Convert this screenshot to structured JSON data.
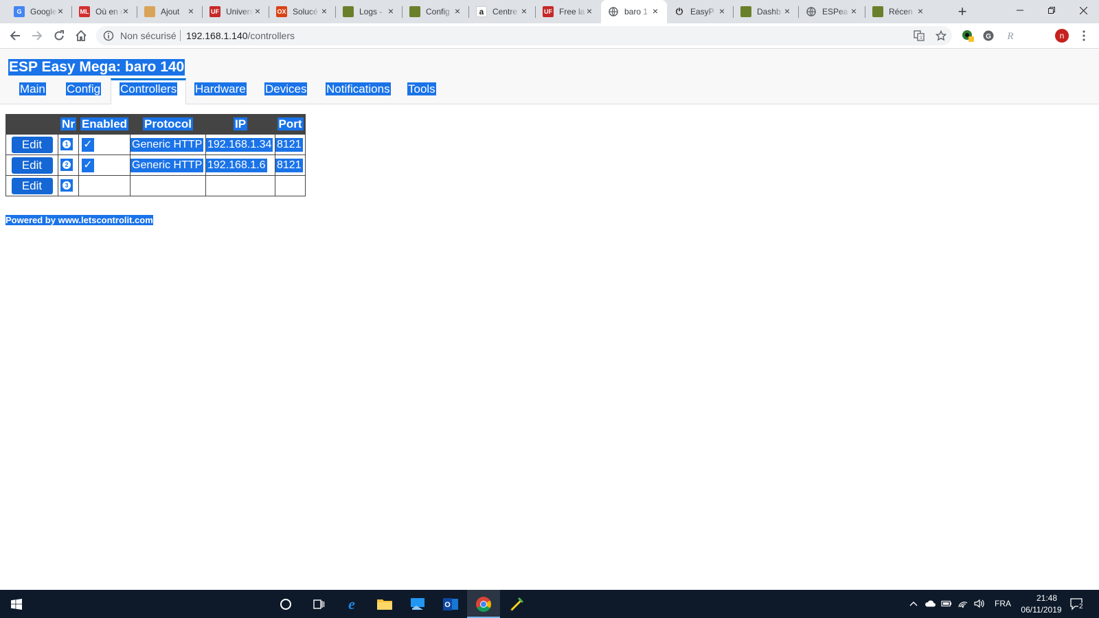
{
  "browser": {
    "tabs": [
      {
        "title": "Google",
        "favicon": "google-gsuite-icon",
        "color": "#4285f4"
      },
      {
        "title": "Où en est",
        "favicon": "ml-icon",
        "color": "#d32f2f"
      },
      {
        "title": "Ajout",
        "favicon": "box-icon",
        "color": "#d9a45a"
      },
      {
        "title": "Univers",
        "favicon": "uf-icon",
        "color": "#c62828"
      },
      {
        "title": "Solucé",
        "favicon": "solucee-icon",
        "color": "#d84315"
      },
      {
        "title": "Logs -",
        "favicon": "letscontrolit-icon",
        "color": "#6a7f2c"
      },
      {
        "title": "Config",
        "favicon": "letscontrolit-icon",
        "color": "#6a7f2c"
      },
      {
        "title": "Centre",
        "favicon": "amazon-icon",
        "color": "#222222"
      },
      {
        "title": "Free la",
        "favicon": "uf-icon",
        "color": "#c62828"
      },
      {
        "title": "baro 1",
        "favicon": "globe-icon",
        "color": "#5f6368",
        "active": true
      },
      {
        "title": "EasyP",
        "favicon": "power-icon",
        "color": "#222222"
      },
      {
        "title": "Dashb",
        "favicon": "letscontrolit-icon",
        "color": "#6a7f2c"
      },
      {
        "title": "ESPea",
        "favicon": "globe-icon",
        "color": "#5f6368"
      },
      {
        "title": "Récen",
        "favicon": "letscontrolit-icon",
        "color": "#6a7f2c"
      }
    ],
    "omnibox": {
      "security_label": "Non sécurisé",
      "host": "192.168.1.140",
      "path": "/controllers"
    },
    "profile_initial": "n"
  },
  "page": {
    "title": "ESP Easy Mega: baro 140",
    "menu": [
      {
        "label": "Main"
      },
      {
        "label": "Config"
      },
      {
        "label": "Controllers",
        "active": true
      },
      {
        "label": "Hardware"
      },
      {
        "label": "Devices"
      },
      {
        "label": "Notifications"
      },
      {
        "label": "Tools"
      }
    ],
    "table": {
      "headers": [
        "",
        "Nr",
        "Enabled",
        "Protocol",
        "IP",
        "Port"
      ],
      "edit_label": "Edit",
      "rows": [
        {
          "nr": "1",
          "enabled": true,
          "protocol": "Generic HTTP",
          "ip": "192.168.1.34",
          "port": "8121"
        },
        {
          "nr": "2",
          "enabled": true,
          "protocol": "Generic HTTP",
          "ip": "192.168.1.6",
          "port": "8121"
        },
        {
          "nr": "3",
          "enabled": false,
          "protocol": "",
          "ip": "",
          "port": ""
        }
      ]
    },
    "footer": "Powered by www.letscontrolit.com"
  },
  "taskbar": {
    "language": "FRA",
    "time": "21:48",
    "date": "06/11/2019",
    "notifications_count": "2"
  },
  "colors": {
    "selection": "#1a73e8",
    "table_header": "#444444",
    "edit_button": "#1467d4",
    "active_tab_border": "#0077dd"
  }
}
